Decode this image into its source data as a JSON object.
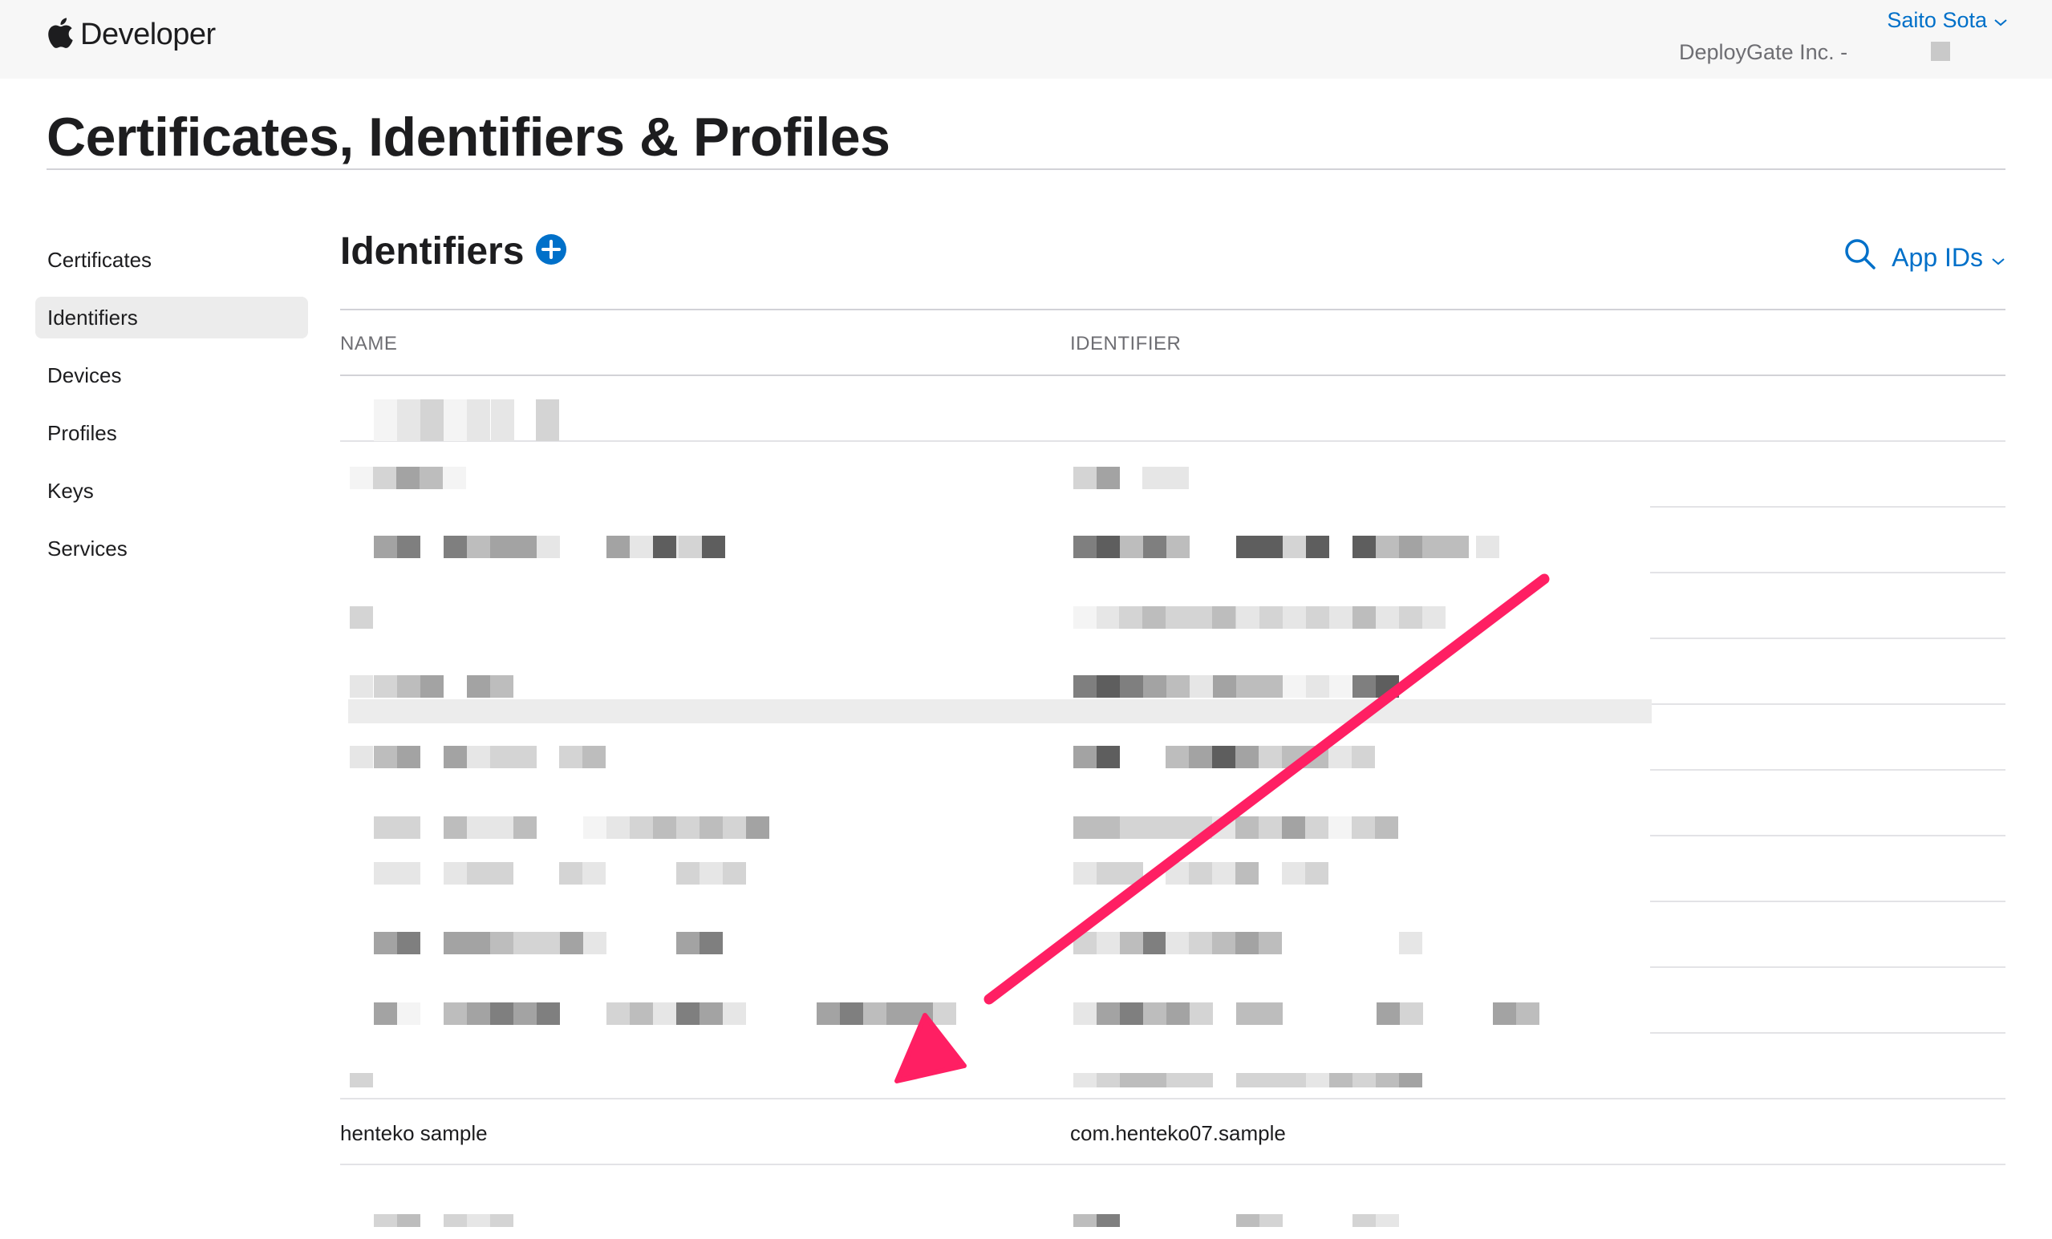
{
  "header": {
    "brand": "Developer",
    "user_name": "Saito Sota",
    "team": "DeployGate Inc. -"
  },
  "page_title": "Certificates, Identifiers & Profiles",
  "sidebar": {
    "items": [
      {
        "label": "Certificates",
        "active": false
      },
      {
        "label": "Identifiers",
        "active": true
      },
      {
        "label": "Devices",
        "active": false
      },
      {
        "label": "Profiles",
        "active": false
      },
      {
        "label": "Keys",
        "active": false
      },
      {
        "label": "Services",
        "active": false
      }
    ]
  },
  "identifiers": {
    "title": "Identifiers",
    "filter_label": "App IDs",
    "columns": {
      "name": "NAME",
      "identifier": "IDENTIFIER"
    },
    "highlighted_row": {
      "name": "henteko sample",
      "identifier": "com.henteko07.sample"
    }
  },
  "colors": {
    "accent": "#0070c9",
    "arrow": "#ff1f63",
    "topbar": "#f7f7f7"
  },
  "icons": [
    "apple-logo-icon",
    "chevron-down-icon",
    "plus-circle-icon",
    "search-icon"
  ]
}
